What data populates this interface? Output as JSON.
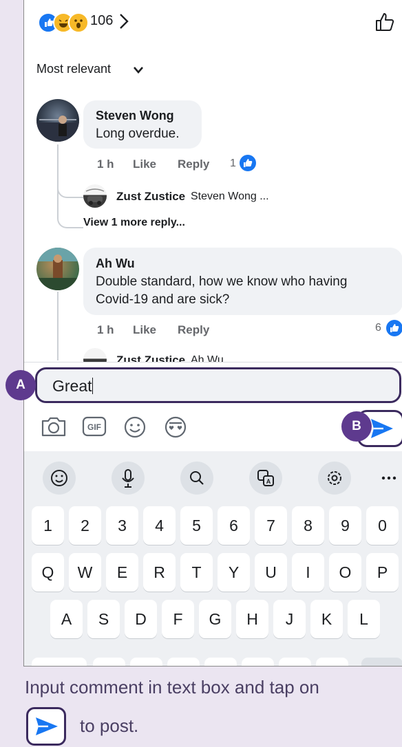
{
  "reactions": {
    "count": "106",
    "icons": [
      "like-icon",
      "laugh-icon",
      "wow-icon"
    ]
  },
  "sort": {
    "label": "Most relevant"
  },
  "comments": [
    {
      "name": "Steven Wong",
      "text": "Long overdue.",
      "time": "1 h",
      "like_label": "Like",
      "reply_label": "Reply",
      "like_count": "1",
      "reply": {
        "name": "Zust Zustice",
        "snippet": "Steven Wong ..."
      },
      "more_replies": "View 1 more reply..."
    },
    {
      "name": "Ah Wu",
      "text_line1": "Double standard, how we know who having",
      "text_line2": "Covid-19 and are sick?",
      "time": "1 h",
      "like_label": "Like",
      "reply_label": "Reply",
      "like_count": "6",
      "reply": {
        "name": "Zust Zustice",
        "snippet": "Ah Wu"
      }
    }
  ],
  "composer": {
    "value": "Great",
    "icons": [
      "camera-icon",
      "gif-icon",
      "smiley-icon",
      "sticker-icon"
    ]
  },
  "keyboard": {
    "toolbar": [
      "emoji-icon",
      "mic-icon",
      "search-icon",
      "translate-icon",
      "settings-icon",
      "more-icon"
    ],
    "row_numbers": [
      "1",
      "2",
      "3",
      "4",
      "5",
      "6",
      "7",
      "8",
      "9",
      "0"
    ],
    "row_q": [
      "Q",
      "W",
      "E",
      "R",
      "T",
      "Y",
      "U",
      "I",
      "O",
      "P"
    ],
    "row_a": [
      "A",
      "S",
      "D",
      "F",
      "G",
      "H",
      "J",
      "K",
      "L"
    ]
  },
  "callouts": {
    "a": "A",
    "b": "B"
  },
  "caption": {
    "line1": "Input comment in text box and tap on",
    "line2": "to post."
  },
  "colors": {
    "accent": "#5e3a8e",
    "fb_blue": "#1877f2",
    "page_bg": "#ebe5f1"
  }
}
